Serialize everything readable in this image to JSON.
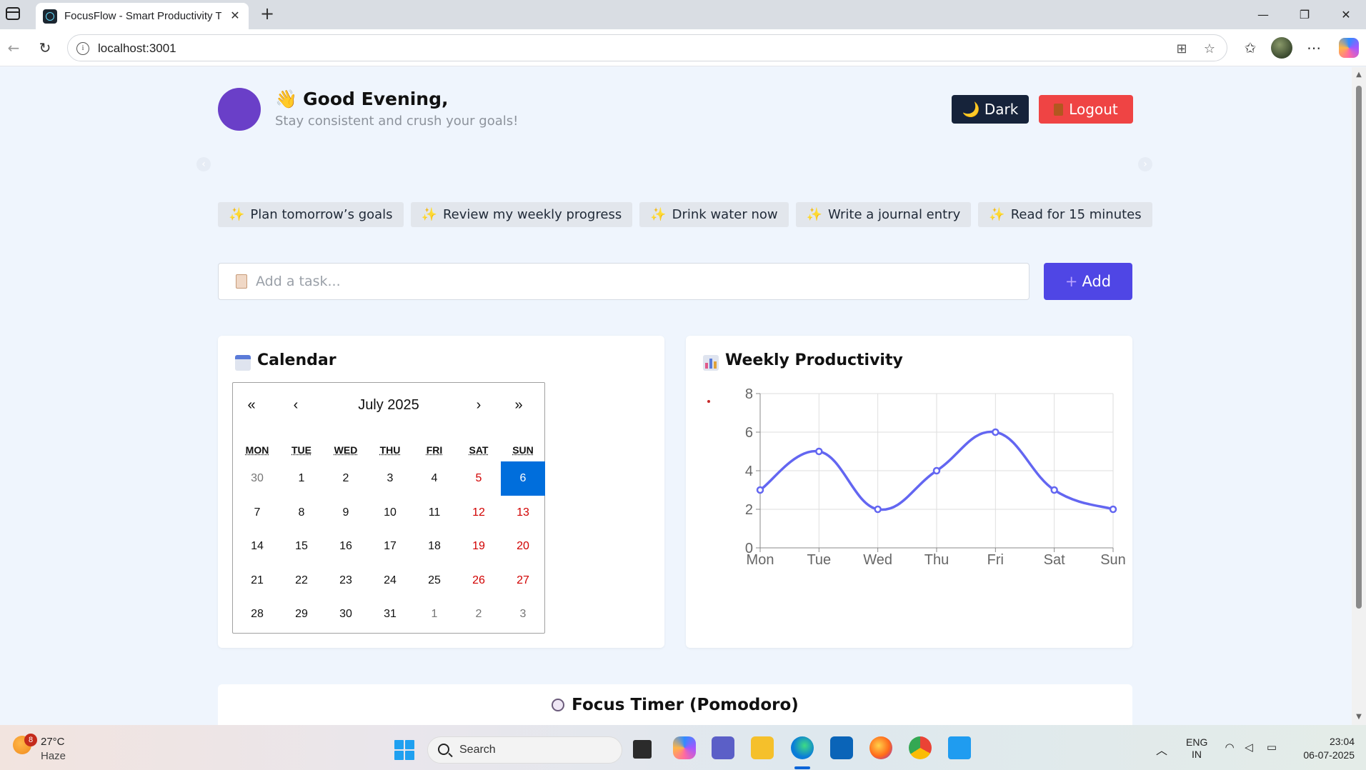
{
  "browser": {
    "tab_title": "FocusFlow - Smart Productivity Tracker",
    "tab_close": "✕",
    "new_tab": "+",
    "url": "localhost:3001",
    "win_minimize": "—",
    "win_restore": "❐",
    "win_close": "✕"
  },
  "header": {
    "wave_icon": "👋",
    "greeting": "Good Evening,",
    "subtitle": "Stay consistent and crush your goals!",
    "dark_icon": "🌙",
    "dark_label": "Dark",
    "logout_label": "Logout"
  },
  "carousel": {
    "prev": "‹",
    "next": "›"
  },
  "suggestions": [
    "Plan tomorrow’s goals",
    "Review my weekly progress",
    "Drink water now",
    "Write a journal entry",
    "Read for 15 minutes"
  ],
  "sparkle": "✨",
  "task": {
    "placeholder": "Add a task...",
    "add_label": "Add",
    "add_icon": "+"
  },
  "calendar": {
    "title": "Calendar",
    "month_label": "July 2025",
    "nav_prev_year": "«",
    "nav_prev": "‹",
    "nav_next": "›",
    "nav_next_year": "»",
    "weekdays": [
      "MON",
      "TUE",
      "WED",
      "THU",
      "FRI",
      "SAT",
      "SUN"
    ],
    "days": [
      [
        "30",
        "1",
        "2",
        "3",
        "4",
        "5",
        "6"
      ],
      [
        "7",
        "8",
        "9",
        "10",
        "11",
        "12",
        "13"
      ],
      [
        "14",
        "15",
        "16",
        "17",
        "18",
        "19",
        "20"
      ],
      [
        "21",
        "22",
        "23",
        "24",
        "25",
        "26",
        "27"
      ],
      [
        "28",
        "29",
        "30",
        "31",
        "1",
        "2",
        "3"
      ]
    ],
    "selected": "6"
  },
  "productivity": {
    "title": "Weekly Productivity",
    "chart_data": {
      "type": "line",
      "categories": [
        "Mon",
        "Tue",
        "Wed",
        "Thu",
        "Fri",
        "Sat",
        "Sun"
      ],
      "series": [
        {
          "values": [
            3,
            5,
            2,
            4,
            6,
            3,
            2
          ],
          "color": "#6366f1"
        }
      ],
      "ylim": [
        0,
        8
      ],
      "yticks": [
        "0",
        "2",
        "4",
        "6",
        "8"
      ],
      "grid": true,
      "title": "",
      "xlabel": "",
      "ylabel": ""
    }
  },
  "timer": {
    "title": "Focus Timer (Pomodoro)"
  },
  "taskbar": {
    "weather_badge": "8",
    "temperature": "27°C",
    "condition": "Haze",
    "search_label": "Search",
    "lang_top": "ENG",
    "lang_bottom": "IN",
    "time": "23:04",
    "date": "06-07-2025"
  }
}
